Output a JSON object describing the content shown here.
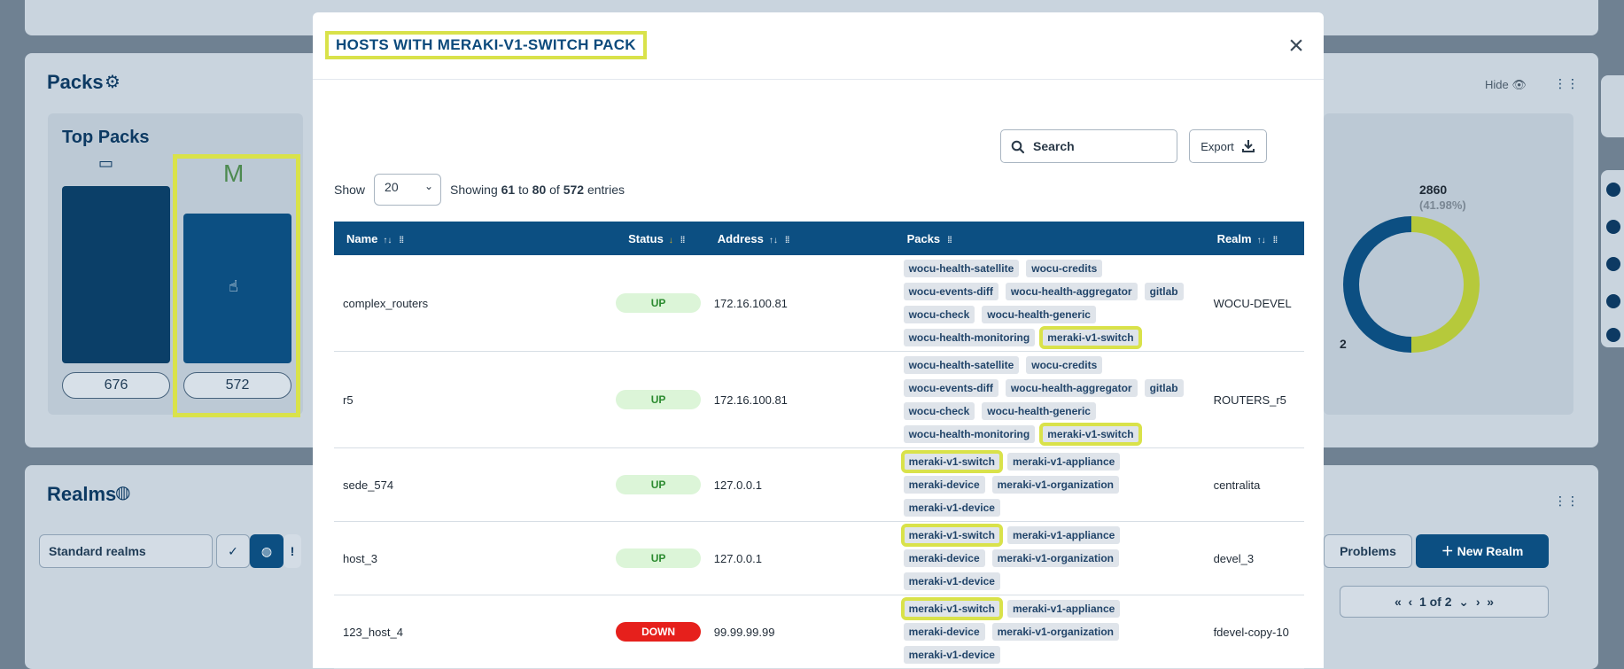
{
  "background": {
    "packs_title": "Packs",
    "top_packs_title": "Top Packs",
    "pack_counts": [
      "676",
      "572"
    ],
    "selected_pack_letter": "M",
    "hide_label": "Hide",
    "donut_value": "2860",
    "donut_percent": "(41.98%)",
    "donut_partial_label": "2",
    "realms_title": "Realms",
    "realm_filter_value": "Standard realms",
    "problems_label": "Problems",
    "new_realm_label": "New Realm",
    "pagination_label": "1 of 2",
    "colors": {
      "accent": "#0c4f82",
      "highlight": "#d9e24a",
      "donut_green": "#b6c93b"
    }
  },
  "modal": {
    "title": "HOSTS WITH MERAKI-V1-SWITCH PACK",
    "search": {
      "placeholder": "Search"
    },
    "export_label": "Export",
    "show_label": "Show",
    "page_size": "20",
    "entries": {
      "prefix": "Showing",
      "from": "61",
      "to_word": "to",
      "to": "80",
      "of_word": "of",
      "total": "572",
      "suffix": "entries"
    },
    "columns": [
      "Name",
      "Status",
      "Address",
      "Packs",
      "Realm"
    ],
    "rows": [
      {
        "name": "complex_routers",
        "status": "UP",
        "address": "172.16.100.81",
        "realm": "WOCU-DEVEL",
        "packs": [
          "wocu-health-satellite",
          "wocu-credits",
          "wocu-events-diff",
          "wocu-health-aggregator",
          "gitlab",
          "wocu-check",
          "wocu-health-generic",
          "wocu-health-monitoring",
          "meraki-v1-switch"
        ]
      },
      {
        "name": "r5",
        "status": "UP",
        "address": "172.16.100.81",
        "realm": "ROUTERS_r5",
        "packs": [
          "wocu-health-satellite",
          "wocu-credits",
          "wocu-events-diff",
          "wocu-health-aggregator",
          "gitlab",
          "wocu-check",
          "wocu-health-generic",
          "wocu-health-monitoring",
          "meraki-v1-switch"
        ]
      },
      {
        "name": "sede_574",
        "status": "UP",
        "address": "127.0.0.1",
        "realm": "centralita",
        "packs": [
          "meraki-v1-switch",
          "meraki-v1-appliance",
          "meraki-device",
          "meraki-v1-organization",
          "meraki-v1-device"
        ]
      },
      {
        "name": "host_3",
        "status": "UP",
        "address": "127.0.0.1",
        "realm": "devel_3",
        "packs": [
          "meraki-v1-switch",
          "meraki-v1-appliance",
          "meraki-device",
          "meraki-v1-organization",
          "meraki-v1-device"
        ]
      },
      {
        "name": "123_host_4",
        "status": "DOWN",
        "address": "99.99.99.99",
        "realm": "fdevel-copy-10",
        "packs": [
          "meraki-v1-switch",
          "meraki-v1-appliance",
          "meraki-device",
          "meraki-v1-organization",
          "meraki-v1-device"
        ]
      }
    ],
    "highlighted_pack": "meraki-v1-switch"
  }
}
